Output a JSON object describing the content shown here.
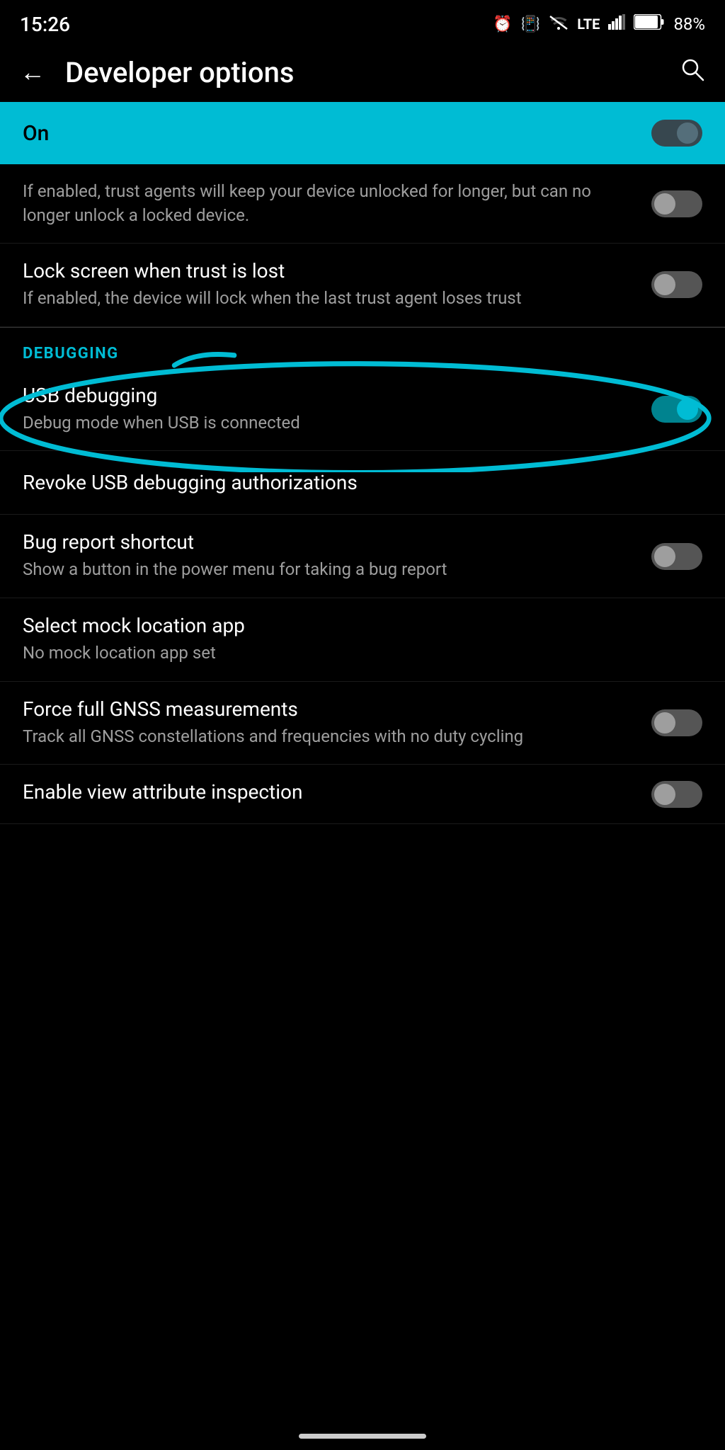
{
  "statusBar": {
    "time": "15:26",
    "battery": "88%",
    "icons": [
      "alarm",
      "vibrate",
      "no-wifi",
      "LTE",
      "signal",
      "battery"
    ]
  },
  "appBar": {
    "title": "Developer options",
    "backLabel": "←",
    "searchLabel": "🔍"
  },
  "onBanner": {
    "label": "On",
    "toggleState": "on"
  },
  "sections": [
    {
      "id": "trust-agents",
      "items": [
        {
          "id": "extend-lock",
          "title": "",
          "subtitle": "If enabled, trust agents will keep your device unlocked for longer, but can no longer unlock a locked device.",
          "hasToggle": true,
          "toggleState": "off"
        },
        {
          "id": "lock-screen-trust",
          "title": "Lock screen when trust is lost",
          "subtitle": "If enabled, the device will lock when the last trust agent loses trust",
          "hasToggle": true,
          "toggleState": "off"
        }
      ]
    },
    {
      "id": "debugging",
      "header": "DEBUGGING",
      "items": [
        {
          "id": "usb-debugging",
          "title": "USB debugging",
          "subtitle": "Debug mode when USB is connected",
          "hasToggle": true,
          "toggleState": "cyan",
          "circled": true
        },
        {
          "id": "revoke-usb",
          "title": "Revoke USB debugging authorizations",
          "subtitle": "",
          "hasToggle": false
        },
        {
          "id": "bug-report",
          "title": "Bug report shortcut",
          "subtitle": "Show a button in the power menu for taking a bug report",
          "hasToggle": true,
          "toggleState": "off"
        },
        {
          "id": "mock-location",
          "title": "Select mock location app",
          "subtitle": "No mock location app set",
          "hasToggle": false
        },
        {
          "id": "gnss",
          "title": "Force full GNSS measurements",
          "subtitle": "Track all GNSS constellations and frequencies with no duty cycling",
          "hasToggle": true,
          "toggleState": "off"
        },
        {
          "id": "view-attribute",
          "title": "Enable view attribute inspection",
          "subtitle": "",
          "hasToggle": true,
          "toggleState": "off"
        }
      ]
    }
  ]
}
